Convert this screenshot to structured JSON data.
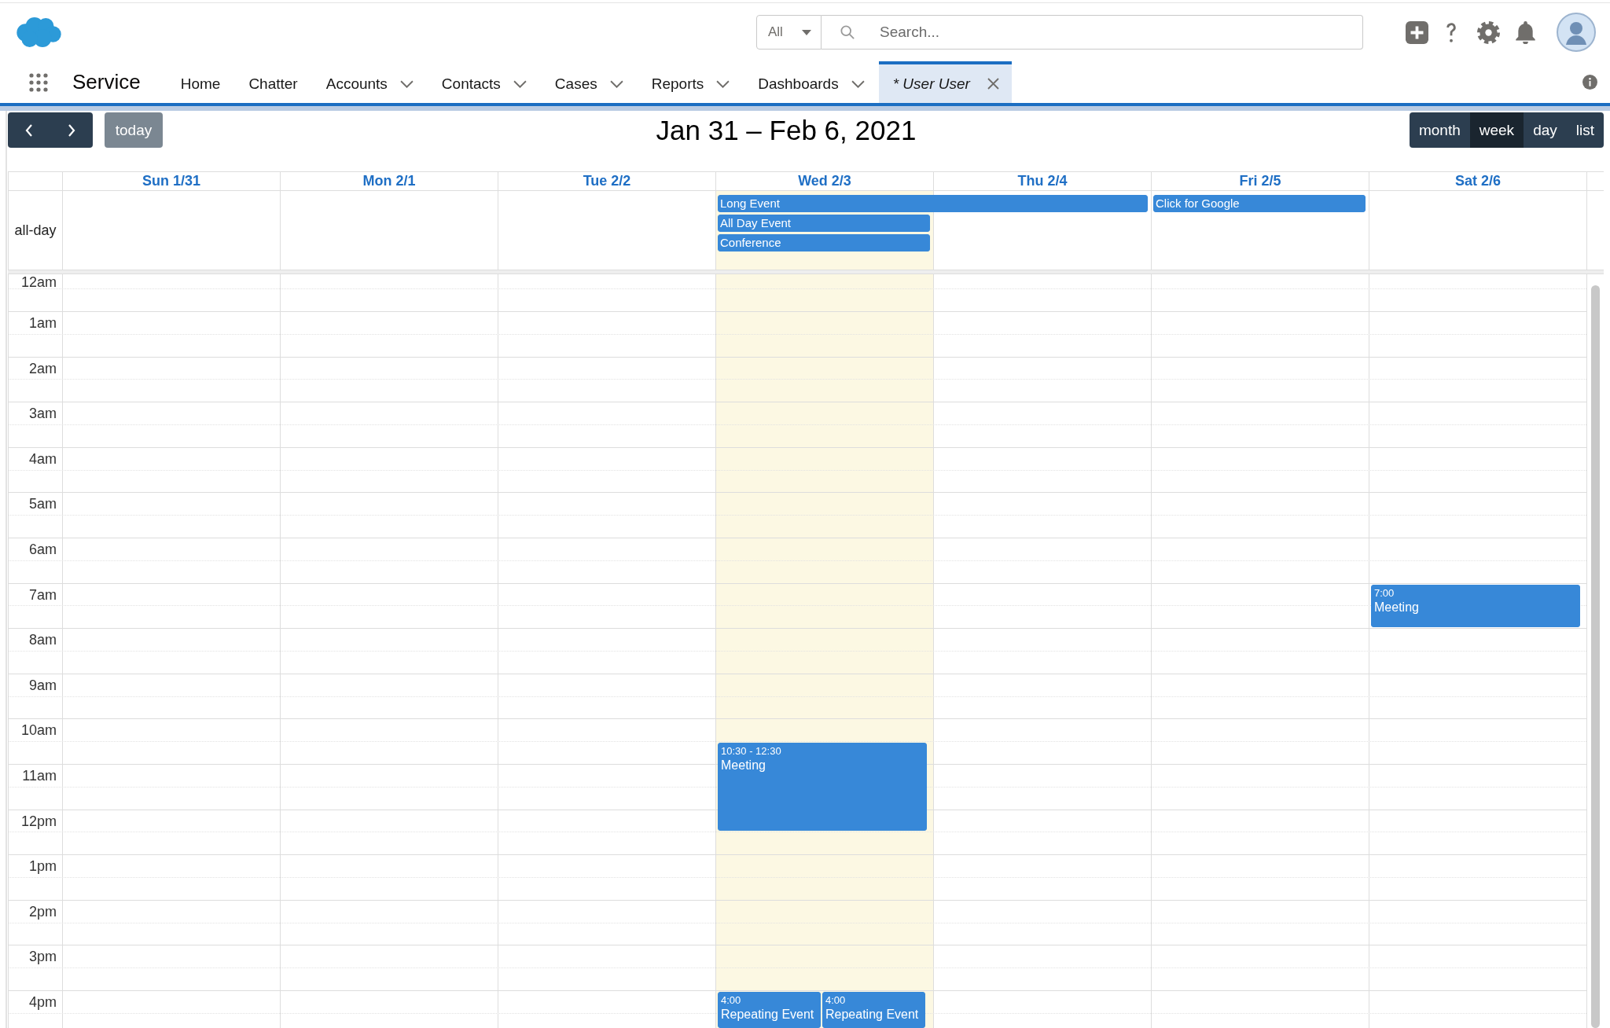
{
  "header": {
    "search_scope": "All",
    "search": {
      "placeholder": "Search..."
    }
  },
  "nav": {
    "app_name": "Service",
    "items": [
      {
        "label": "Home",
        "kind": "link",
        "selected": false
      },
      {
        "label": "Chatter",
        "kind": "link",
        "selected": false
      },
      {
        "label": "Accounts",
        "kind": "menu",
        "selected": false
      },
      {
        "label": "Contacts",
        "kind": "menu",
        "selected": false
      },
      {
        "label": "Cases",
        "kind": "menu",
        "selected": false
      },
      {
        "label": "Reports",
        "kind": "menu",
        "selected": false
      },
      {
        "label": "Dashboards",
        "kind": "menu",
        "selected": false
      },
      {
        "label": "* User User",
        "kind": "record",
        "selected": true
      }
    ]
  },
  "toolbar": {
    "today": {
      "label": "today",
      "disabled": true
    },
    "title": "Jan 31 – Feb 6, 2021",
    "views": [
      {
        "label": "month",
        "selected": false
      },
      {
        "label": "week",
        "selected": true
      },
      {
        "label": "day",
        "selected": false
      },
      {
        "label": "list",
        "selected": false
      }
    ]
  },
  "calendar": {
    "allday_label": "all-day",
    "hours": [
      "12am",
      "1am",
      "2am",
      "3am",
      "4am",
      "5am",
      "6am",
      "7am",
      "8am",
      "9am",
      "10am",
      "11am",
      "12pm",
      "1pm",
      "2pm",
      "3pm",
      "4pm"
    ],
    "days": [
      {
        "label": "Sun 1/31",
        "today": false
      },
      {
        "label": "Mon 2/1",
        "today": false
      },
      {
        "label": "Tue 2/2",
        "today": false
      },
      {
        "label": "Wed 2/3",
        "today": true,
        "allday_events": [
          {
            "title": "Long Event",
            "continues_next_day": true
          },
          {
            "title": "All Day Event",
            "continues_next_day": false
          },
          {
            "title": "Conference",
            "continues_next_day": false
          }
        ],
        "events": [
          {
            "time": "10:30 - 12:30",
            "title": "Meeting"
          },
          {
            "time": "4:00",
            "title": "Repeating Event"
          },
          {
            "time": "4:00",
            "title": "Repeating Event"
          }
        ]
      },
      {
        "label": "Thu 2/4",
        "today": false
      },
      {
        "label": "Fri 2/5",
        "today": false,
        "allday_events": [
          {
            "title": "Click for Google",
            "continues_next_day": false
          }
        ]
      },
      {
        "label": "Sat 2/6",
        "today": false,
        "events": [
          {
            "time": "7:00",
            "title": "Meeting"
          }
        ]
      }
    ]
  }
}
